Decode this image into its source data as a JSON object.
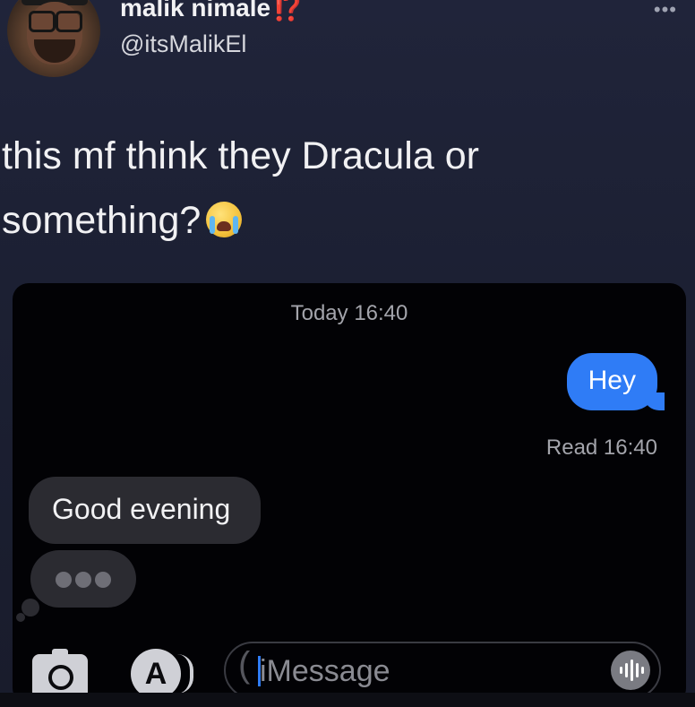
{
  "tweet": {
    "author": {
      "display_name": "malik nimale",
      "name_emoji": "⁉️",
      "handle": "@itsMalikEl"
    },
    "more_icon": "more-dots-icon",
    "text_line1": "this mf think they Dracula or",
    "text_line2": "something?",
    "emoji": "loudly-crying-face"
  },
  "imessage": {
    "timestamp": "Today 16:40",
    "messages": [
      {
        "direction": "sent",
        "text": "Hey"
      },
      {
        "direction": "received",
        "text": "Good evening"
      }
    ],
    "read_receipt": "Read 16:40",
    "typing_indicator": "•••",
    "input": {
      "placeholder": "iMessage"
    },
    "icons": [
      "camera-icon",
      "app-store-icon",
      "audio-waveform-icon"
    ],
    "colors": {
      "sent_bubble": "#2f7cf6",
      "received_bubble": "#2b2b31",
      "background": "#020205"
    }
  }
}
